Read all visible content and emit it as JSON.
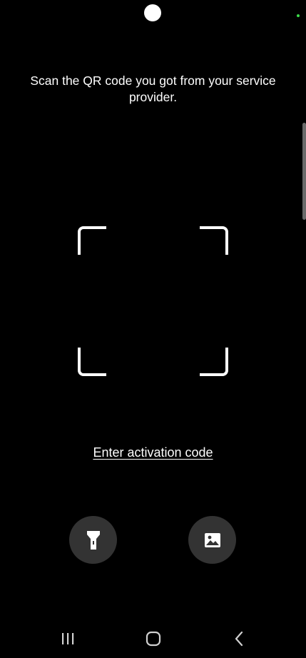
{
  "screen": {
    "instruction": "Scan the QR code you got from your service provider.",
    "activation_link": "Enter activation code"
  },
  "buttons": {
    "flashlight_icon": "flashlight-icon",
    "gallery_icon": "image-icon"
  },
  "navigation": {
    "recents_icon": "recents-icon",
    "home_icon": "home-icon",
    "back_icon": "back-icon"
  },
  "colors": {
    "background": "#000000",
    "foreground": "#ffffff",
    "button_bg": "#333333",
    "status_dot": "#3ddc4a"
  }
}
